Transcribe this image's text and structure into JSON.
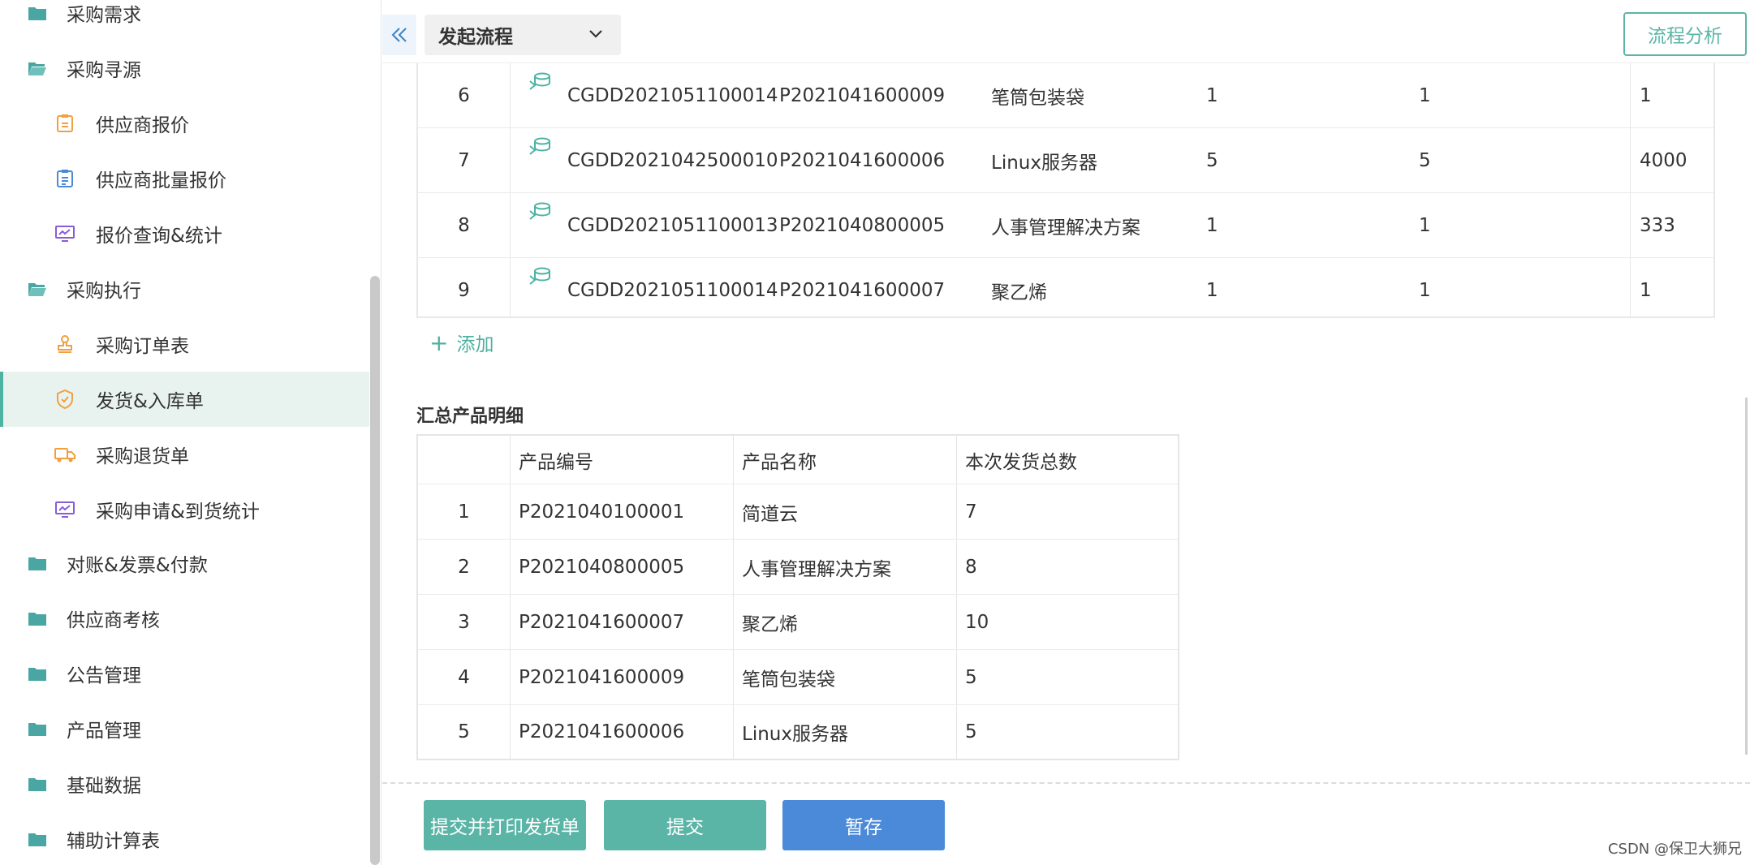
{
  "sidebar": {
    "items": [
      {
        "label": "采购需求",
        "icon": "folder-icon"
      },
      {
        "label": "采购寻源",
        "icon": "folder-open-icon"
      },
      {
        "label": "供应商报价",
        "icon": "quote-doc-icon"
      },
      {
        "label": "供应商批量报价",
        "icon": "clipboard-icon"
      },
      {
        "label": "报价查询&统计",
        "icon": "monitor-chart-icon"
      },
      {
        "label": "采购执行",
        "icon": "folder-open-icon"
      },
      {
        "label": "采购订单表",
        "icon": "stamp-icon"
      },
      {
        "label": "发货&入库单",
        "icon": "shield-check-icon"
      },
      {
        "label": "采购退货单",
        "icon": "truck-icon"
      },
      {
        "label": "采购申请&到货统计",
        "icon": "monitor-chart-icon"
      },
      {
        "label": "对账&发票&付款",
        "icon": "folder-icon"
      },
      {
        "label": "供应商考核",
        "icon": "folder-icon"
      },
      {
        "label": "公告管理",
        "icon": "folder-icon"
      },
      {
        "label": "产品管理",
        "icon": "folder-icon"
      },
      {
        "label": "基础数据",
        "icon": "folder-icon"
      },
      {
        "label": "辅助计算表",
        "icon": "folder-icon"
      }
    ]
  },
  "topbar": {
    "flow_select": "发起流程",
    "analysis_button": "流程分析"
  },
  "detail_table": {
    "rows": [
      {
        "index": "6",
        "order_no": "CGDD2021051100014",
        "product_code": "P2021041600009",
        "product_name": "笔筒包装袋",
        "qty1": "1",
        "qty2": "1",
        "qty3": "1"
      },
      {
        "index": "7",
        "order_no": "CGDD2021042500010",
        "product_code": "P2021041600006",
        "product_name": "Linux服务器",
        "qty1": "5",
        "qty2": "5",
        "qty3": "4000"
      },
      {
        "index": "8",
        "order_no": "CGDD2021051100013",
        "product_code": "P2021040800005",
        "product_name": "人事管理解决方案",
        "qty1": "1",
        "qty2": "1",
        "qty3": "333"
      },
      {
        "index": "9",
        "order_no": "CGDD2021051100014",
        "product_code": "P2021041600007",
        "product_name": "聚乙烯",
        "qty1": "1",
        "qty2": "1",
        "qty3": "1"
      }
    ]
  },
  "add_link": "添加",
  "summary": {
    "title": "汇总产品明细",
    "headers": [
      "",
      "产品编号",
      "产品名称",
      "本次发货总数"
    ],
    "rows": [
      {
        "index": "1",
        "code": "P2021040100001",
        "name": "简道云",
        "total": "7"
      },
      {
        "index": "2",
        "code": "P2021040800005",
        "name": "人事管理解决方案",
        "total": "8"
      },
      {
        "index": "3",
        "code": "P2021041600007",
        "name": "聚乙烯",
        "total": "10"
      },
      {
        "index": "4",
        "code": "P2021041600009",
        "name": "笔筒包装袋",
        "total": "5"
      },
      {
        "index": "5",
        "code": "P2021041600006",
        "name": "Linux服务器",
        "total": "5"
      }
    ]
  },
  "buttons": {
    "submit_print": "提交并打印发货单",
    "submit": "提交",
    "save_draft": "暂存"
  },
  "watermark": "CSDN @保卫大狮兄",
  "colors": {
    "accent_teal": "#5bb5a7",
    "primary_blue": "#4a8ad8",
    "active_bg": "#e8f3f0",
    "folder_icon": "#4aa6a2",
    "orange_icon": "#f0a040",
    "purple_icon": "#8a5cd6"
  }
}
